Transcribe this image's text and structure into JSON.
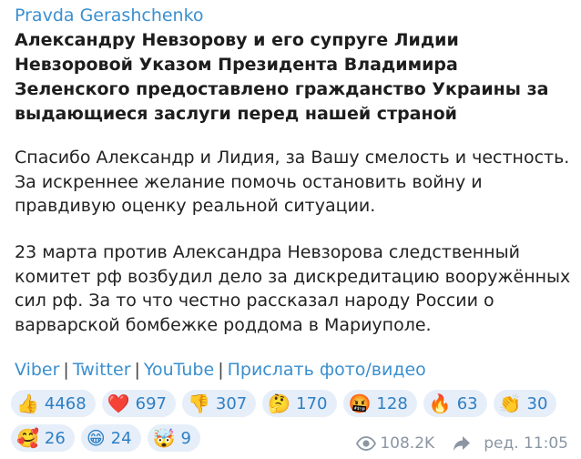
{
  "channel": {
    "name": "Pravda Gerashchenko"
  },
  "post": {
    "headline": "Александру Невзорову и его супруге Лидии Невзоровой Указом Президента Владимира Зеленского предоставлено гражданство Украины за выдающиеся заслуги перед нашей страной",
    "paragraph1": "Спасибо Александр и Лидия, за Вашу смелость и честность. За искреннее желание помочь остановить войну и правдивую оценку реальной ситуации.",
    "paragraph2": "23 марта против Александра Невзорова следственный комитет рф возбудил дело за дискредитацию вооружённых сил рф. За то что честно рассказал народу России о варварской бомбежке роддома в Мариуполе."
  },
  "links": {
    "viber": "Viber",
    "twitter": "Twitter",
    "youtube": "YouTube",
    "submit": "Прислать фото/видео",
    "separator": "|"
  },
  "reactions": [
    {
      "emoji": "👍",
      "icon": "thumbs-up",
      "count": "4468"
    },
    {
      "emoji": "❤️",
      "icon": "heart",
      "count": "697"
    },
    {
      "emoji": "👎",
      "icon": "thumbs-down",
      "count": "307"
    },
    {
      "emoji": "🤔",
      "icon": "thinking-face",
      "count": "170"
    },
    {
      "emoji": "🤬",
      "icon": "cursing-face",
      "count": "128"
    },
    {
      "emoji": "🔥",
      "icon": "fire",
      "count": "63"
    },
    {
      "emoji": "👏",
      "icon": "clapping-hands",
      "count": "30"
    },
    {
      "emoji": "🥰",
      "icon": "smiling-face-with-hearts",
      "count": "26"
    },
    {
      "emoji": "😁",
      "icon": "grinning-face",
      "count": "24"
    },
    {
      "emoji": "🤯",
      "icon": "exploding-head",
      "count": "9"
    }
  ],
  "meta": {
    "views": "108.2K",
    "edited_time": "ред. 11:05",
    "view_icon": "eye-icon",
    "forward_icon": "forward-icon"
  },
  "colors": {
    "link": "#3a8fd0",
    "reaction_bg": "#e6eef9",
    "meta": "#8b96a3"
  }
}
